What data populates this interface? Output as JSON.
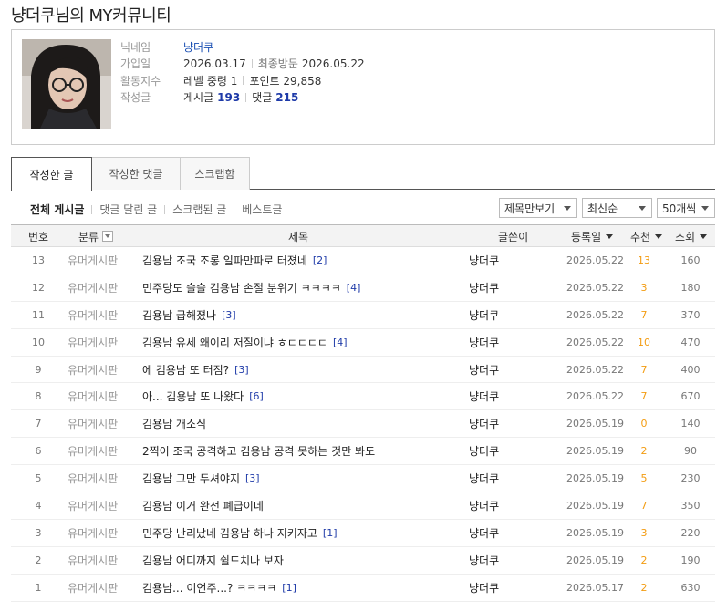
{
  "page_title": "냥더쿠님의 MY커뮤니티",
  "profile": {
    "nickname_label": "닉네임",
    "nickname": "냥더쿠",
    "joined_label": "가입일",
    "joined": "2026.03.17",
    "last_visit_label": "최종방문",
    "last_visit": "2026.05.22",
    "activity_label": "활동지수",
    "level_text": "레벨 중령 1",
    "points_text": "포인트 29,858",
    "posts_label": "작성글",
    "post_count_label": "게시글",
    "post_count": "193",
    "comment_count_label": "댓글",
    "comment_count": "215"
  },
  "tabs": [
    "작성한 글",
    "작성한 댓글",
    "스크랩함"
  ],
  "filters": [
    "전체 게시글",
    "댓글 달린 글",
    "스크랩된 글",
    "베스트글"
  ],
  "selects": {
    "view_mode": "제목만보기",
    "sort": "최신순",
    "per_page": "50개씩"
  },
  "columns": {
    "num": "번호",
    "category": "분류",
    "title": "제목",
    "writer": "글쓴이",
    "date": "등록일",
    "recommend": "추천",
    "views": "조회"
  },
  "posts": [
    {
      "num": "13",
      "category": "유머게시판",
      "title": "김용남 조국 조롱 일파만파로 터졌네",
      "comments": "[2]",
      "writer": "냥더쿠",
      "date": "2026.05.22",
      "recommend": "13",
      "views": "160"
    },
    {
      "num": "12",
      "category": "유머게시판",
      "title": "민주당도 슬슬 김용남 손절 분위기 ㅋㅋㅋㅋ",
      "comments": "[4]",
      "writer": "냥더쿠",
      "date": "2026.05.22",
      "recommend": "3",
      "views": "180"
    },
    {
      "num": "11",
      "category": "유머게시판",
      "title": "김용남 급해졌나",
      "comments": "[3]",
      "writer": "냥더쿠",
      "date": "2026.05.22",
      "recommend": "7",
      "views": "370"
    },
    {
      "num": "10",
      "category": "유머게시판",
      "title": "김용남 유세 왜이리 저질이냐 ㅎㄷㄷㄷㄷ",
      "comments": "[4]",
      "writer": "냥더쿠",
      "date": "2026.05.22",
      "recommend": "10",
      "views": "470"
    },
    {
      "num": "9",
      "category": "유머게시판",
      "title": "에 김용남 또 터짐?",
      "comments": "[3]",
      "writer": "냥더쿠",
      "date": "2026.05.22",
      "recommend": "7",
      "views": "400"
    },
    {
      "num": "8",
      "category": "유머게시판",
      "title": "아... 김용남 또 나왔다",
      "comments": "[6]",
      "writer": "냥더쿠",
      "date": "2026.05.22",
      "recommend": "7",
      "views": "670"
    },
    {
      "num": "7",
      "category": "유머게시판",
      "title": "김용남 개소식",
      "comments": "",
      "writer": "냥더쿠",
      "date": "2026.05.19",
      "recommend": "0",
      "views": "140"
    },
    {
      "num": "6",
      "category": "유머게시판",
      "title": "2찍이 조국 공격하고 김용남 공격 못하는 것만 봐도",
      "comments": "",
      "writer": "냥더쿠",
      "date": "2026.05.19",
      "recommend": "2",
      "views": "90"
    },
    {
      "num": "5",
      "category": "유머게시판",
      "title": "김용남 그만 두셔야지",
      "comments": "[3]",
      "writer": "냥더쿠",
      "date": "2026.05.19",
      "recommend": "5",
      "views": "230"
    },
    {
      "num": "4",
      "category": "유머게시판",
      "title": "김용남 이거 완전 폐급이네",
      "comments": "",
      "writer": "냥더쿠",
      "date": "2026.05.19",
      "recommend": "7",
      "views": "350"
    },
    {
      "num": "3",
      "category": "유머게시판",
      "title": "민주당 난리났네 김용남 하나 지키자고",
      "comments": "[1]",
      "writer": "냥더쿠",
      "date": "2026.05.19",
      "recommend": "3",
      "views": "220"
    },
    {
      "num": "2",
      "category": "유머게시판",
      "title": "김용남 어디까지 쉴드치나 보자",
      "comments": "",
      "writer": "냥더쿠",
      "date": "2026.05.19",
      "recommend": "2",
      "views": "190"
    },
    {
      "num": "1",
      "category": "유머게시판",
      "title": "김용남... 이언주...? ㅋㅋㅋㅋ",
      "comments": "[1]",
      "writer": "냥더쿠",
      "date": "2026.05.17",
      "recommend": "2",
      "views": "630"
    }
  ]
}
